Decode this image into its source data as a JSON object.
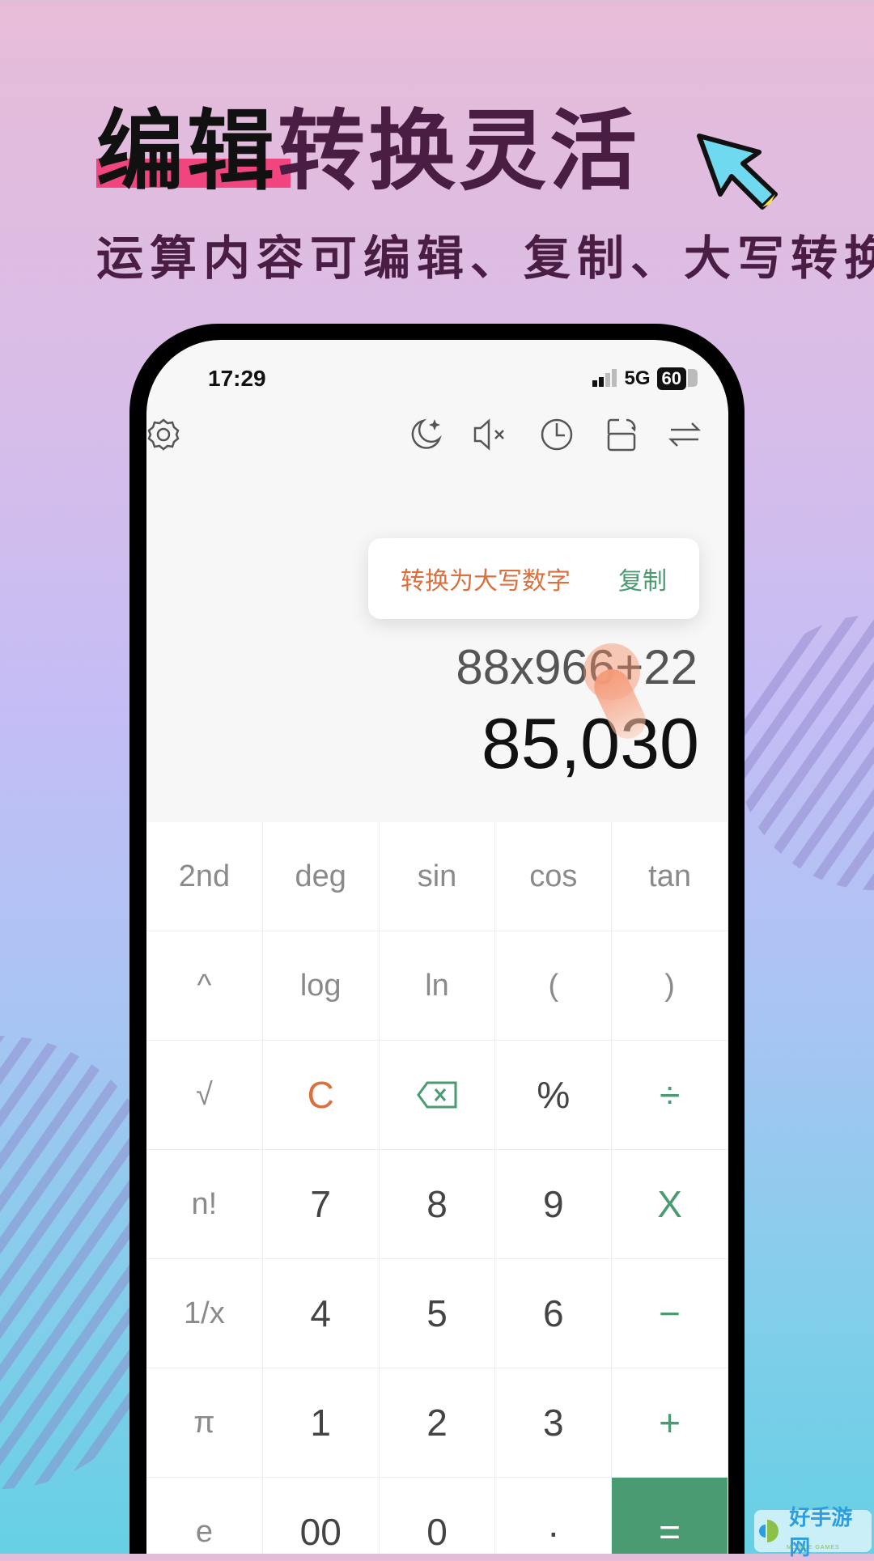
{
  "promo": {
    "headline_black": "编辑",
    "headline_rest": "转换灵活",
    "subtitle": "运算内容可编辑、复制、大写转换"
  },
  "status": {
    "time": "17:29",
    "network": "5G",
    "battery": "60"
  },
  "toolbar": {
    "icons": [
      "settings-icon",
      "dark-mode-icon",
      "mute-icon",
      "history-icon",
      "rotate-icon",
      "convert-icon"
    ]
  },
  "popup": {
    "convert_label": "转换为大写数字",
    "copy_label": "复制"
  },
  "display": {
    "expression": "88x966+22",
    "result": "85,030"
  },
  "keypad": {
    "keys": [
      {
        "label": "2nd",
        "type": "sci"
      },
      {
        "label": "deg",
        "type": "sci"
      },
      {
        "label": "sin",
        "type": "sci"
      },
      {
        "label": "cos",
        "type": "sci"
      },
      {
        "label": "tan",
        "type": "sci"
      },
      {
        "label": "^",
        "type": "sci"
      },
      {
        "label": "log",
        "type": "sci"
      },
      {
        "label": "ln",
        "type": "sci"
      },
      {
        "label": "(",
        "type": "sci"
      },
      {
        "label": ")",
        "type": "sci"
      },
      {
        "label": "√",
        "type": "sci"
      },
      {
        "label": "C",
        "type": "clr"
      },
      {
        "label": "",
        "type": "backspace"
      },
      {
        "label": "%",
        "type": "num"
      },
      {
        "label": "÷",
        "type": "op"
      },
      {
        "label": "n!",
        "type": "sci"
      },
      {
        "label": "7",
        "type": "num"
      },
      {
        "label": "8",
        "type": "num"
      },
      {
        "label": "9",
        "type": "num"
      },
      {
        "label": "X",
        "type": "op"
      },
      {
        "label": "1/x",
        "type": "sci"
      },
      {
        "label": "4",
        "type": "num"
      },
      {
        "label": "5",
        "type": "num"
      },
      {
        "label": "6",
        "type": "num"
      },
      {
        "label": "−",
        "type": "op"
      },
      {
        "label": "π",
        "type": "sci"
      },
      {
        "label": "1",
        "type": "num"
      },
      {
        "label": "2",
        "type": "num"
      },
      {
        "label": "3",
        "type": "num"
      },
      {
        "label": "+",
        "type": "op"
      },
      {
        "label": "e",
        "type": "sci"
      },
      {
        "label": "00",
        "type": "num"
      },
      {
        "label": "0",
        "type": "num"
      },
      {
        "label": "·",
        "type": "num"
      },
      {
        "label": "=",
        "type": "eq"
      }
    ]
  },
  "watermark": {
    "text": "好手游网",
    "sub": "MOBILE GAMES"
  },
  "colors": {
    "accent_green": "#4a9a72",
    "accent_orange": "#d9703d",
    "headline": "#4a1d45",
    "highlight": "#f0457e"
  }
}
